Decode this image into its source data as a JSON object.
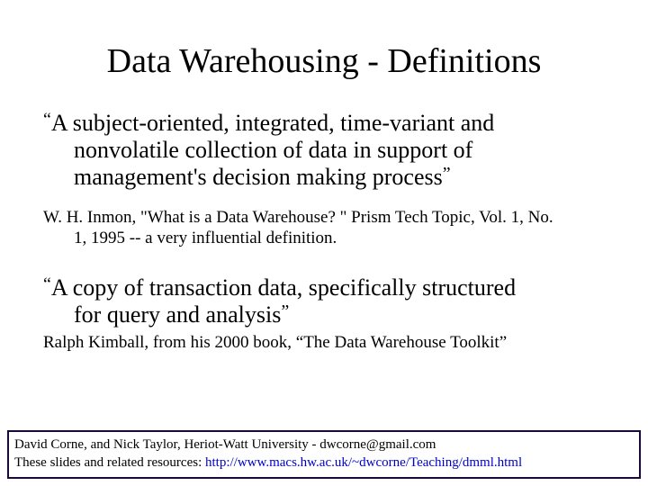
{
  "title": "Data Warehousing - Definitions",
  "quote1": {
    "open": "“",
    "line1": "A subject-oriented, integrated, time-variant and",
    "line2": "nonvolatile collection of data in support of",
    "line3": "management's decision making process",
    "close": "”"
  },
  "cite1": {
    "line1": "W. H. Inmon, \"What is a Data Warehouse? \" Prism Tech Topic, Vol. 1, No.",
    "line2": "1, 1995    -- a very influential definition."
  },
  "quote2": {
    "open": "“",
    "line1": "A copy of transaction data, specifically structured",
    "line2": "for query and analysis",
    "close": "”"
  },
  "cite2": "Ralph Kimball, from his 2000 book, “The Data Warehouse Toolkit”",
  "footer": {
    "line1_pre": "David Corne, and Nick Taylor,  Heriot-Watt University  -  dwcorne@gmail.com",
    "line2_pre": "These slides and related resources:   ",
    "url": "http://www.macs.hw.ac.uk/~dwcorne/Teaching/dmml.html"
  }
}
